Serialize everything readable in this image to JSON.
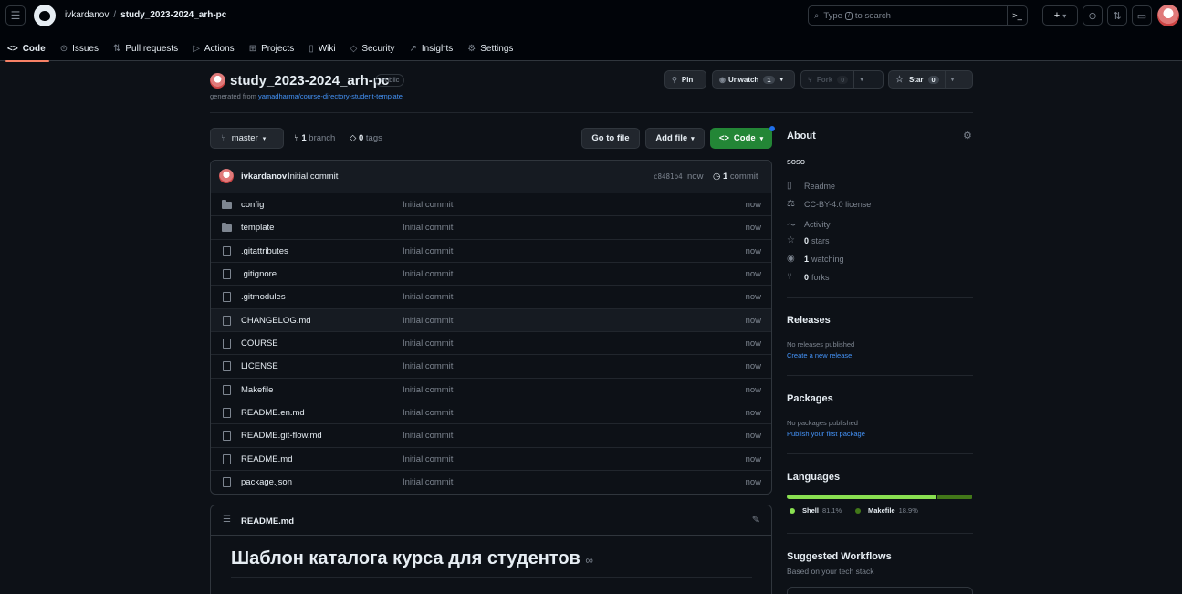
{
  "header": {
    "owner": "ivkardanov",
    "separator": "/",
    "repo": "study_2023-2024_arh-pc",
    "search_text_before": "Type",
    "search_kbd": "/",
    "search_text_after": "to search",
    "cmd_icon": ">_",
    "plus_icon": "+",
    "caret": "▾"
  },
  "tabs": [
    {
      "label": "Code",
      "icon": "<>",
      "active": true
    },
    {
      "label": "Issues",
      "icon": "⊙"
    },
    {
      "label": "Pull requests",
      "icon": "⇅"
    },
    {
      "label": "Actions",
      "icon": "▷"
    },
    {
      "label": "Projects",
      "icon": "⊞"
    },
    {
      "label": "Wiki",
      "icon": "▯"
    },
    {
      "label": "Security",
      "icon": "◇"
    },
    {
      "label": "Insights",
      "icon": "↗"
    },
    {
      "label": "Settings",
      "icon": "⚙"
    }
  ],
  "repo": {
    "title": "study_2023-2024_arh-pc",
    "visibility": "Public",
    "generated_prefix": "generated from",
    "generated_link": "yamadharma/course-directory-student-template",
    "pin": "Pin",
    "unwatch": "Unwatch",
    "unwatch_count": "1",
    "fork": "Fork",
    "fork_count": "0",
    "star": "Star",
    "star_count": "0"
  },
  "branch": {
    "name": "master",
    "branch_count": "1",
    "branch_label": "branch",
    "tag_count": "0",
    "tag_label": "tags",
    "go_to_file": "Go to file",
    "add_file": "Add file",
    "code": "Code"
  },
  "latest_commit": {
    "user": "ivkardanov",
    "message": "Initial commit",
    "hash": "c8481b4",
    "time": "now",
    "count": "1",
    "count_label": "commit"
  },
  "files": [
    {
      "name": "config",
      "type": "dir",
      "message": "Initial commit",
      "time": "now"
    },
    {
      "name": "template",
      "type": "dir",
      "message": "Initial commit",
      "time": "now"
    },
    {
      "name": ".gitattributes",
      "type": "file",
      "message": "Initial commit",
      "time": "now"
    },
    {
      "name": ".gitignore",
      "type": "file",
      "message": "Initial commit",
      "time": "now"
    },
    {
      "name": ".gitmodules",
      "type": "file",
      "message": "Initial commit",
      "time": "now"
    },
    {
      "name": "CHANGELOG.md",
      "type": "file",
      "message": "Initial commit",
      "time": "now",
      "highlight": true
    },
    {
      "name": "COURSE",
      "type": "file",
      "message": "Initial commit",
      "time": "now"
    },
    {
      "name": "LICENSE",
      "type": "file",
      "message": "Initial commit",
      "time": "now"
    },
    {
      "name": "Makefile",
      "type": "file",
      "message": "Initial commit",
      "time": "now"
    },
    {
      "name": "README.en.md",
      "type": "file",
      "message": "Initial commit",
      "time": "now"
    },
    {
      "name": "README.git-flow.md",
      "type": "file",
      "message": "Initial commit",
      "time": "now"
    },
    {
      "name": "README.md",
      "type": "file",
      "message": "Initial commit",
      "time": "now"
    },
    {
      "name": "package.json",
      "type": "file",
      "message": "Initial commit",
      "time": "now"
    }
  ],
  "readme": {
    "filename": "README.md",
    "heading": "Шаблон каталога курса для студентов"
  },
  "about": {
    "title": "About",
    "description": "soso",
    "readme": "Readme",
    "license": "CC-BY-4.0 license",
    "activity": "Activity",
    "stars_count": "0",
    "stars_label": "stars",
    "watching_count": "1",
    "watching_label": "watching",
    "forks_count": "0",
    "forks_label": "forks"
  },
  "releases": {
    "title": "Releases",
    "none": "No releases published",
    "create": "Create a new release"
  },
  "packages": {
    "title": "Packages",
    "none": "No packages published",
    "publish": "Publish your first package"
  },
  "languages": {
    "title": "Languages",
    "items": [
      {
        "name": "Shell",
        "percent": "81.1%",
        "value": 81.1,
        "color": "#89e051"
      },
      {
        "name": "Makefile",
        "percent": "18.9%",
        "value": 18.9,
        "color": "#427819"
      }
    ]
  },
  "workflows": {
    "title": "Suggested Workflows",
    "subtitle": "Based on your tech stack"
  },
  "colors": {
    "accent_tab": "#f78166",
    "link": "#4493f8",
    "code_button": "#238636"
  }
}
